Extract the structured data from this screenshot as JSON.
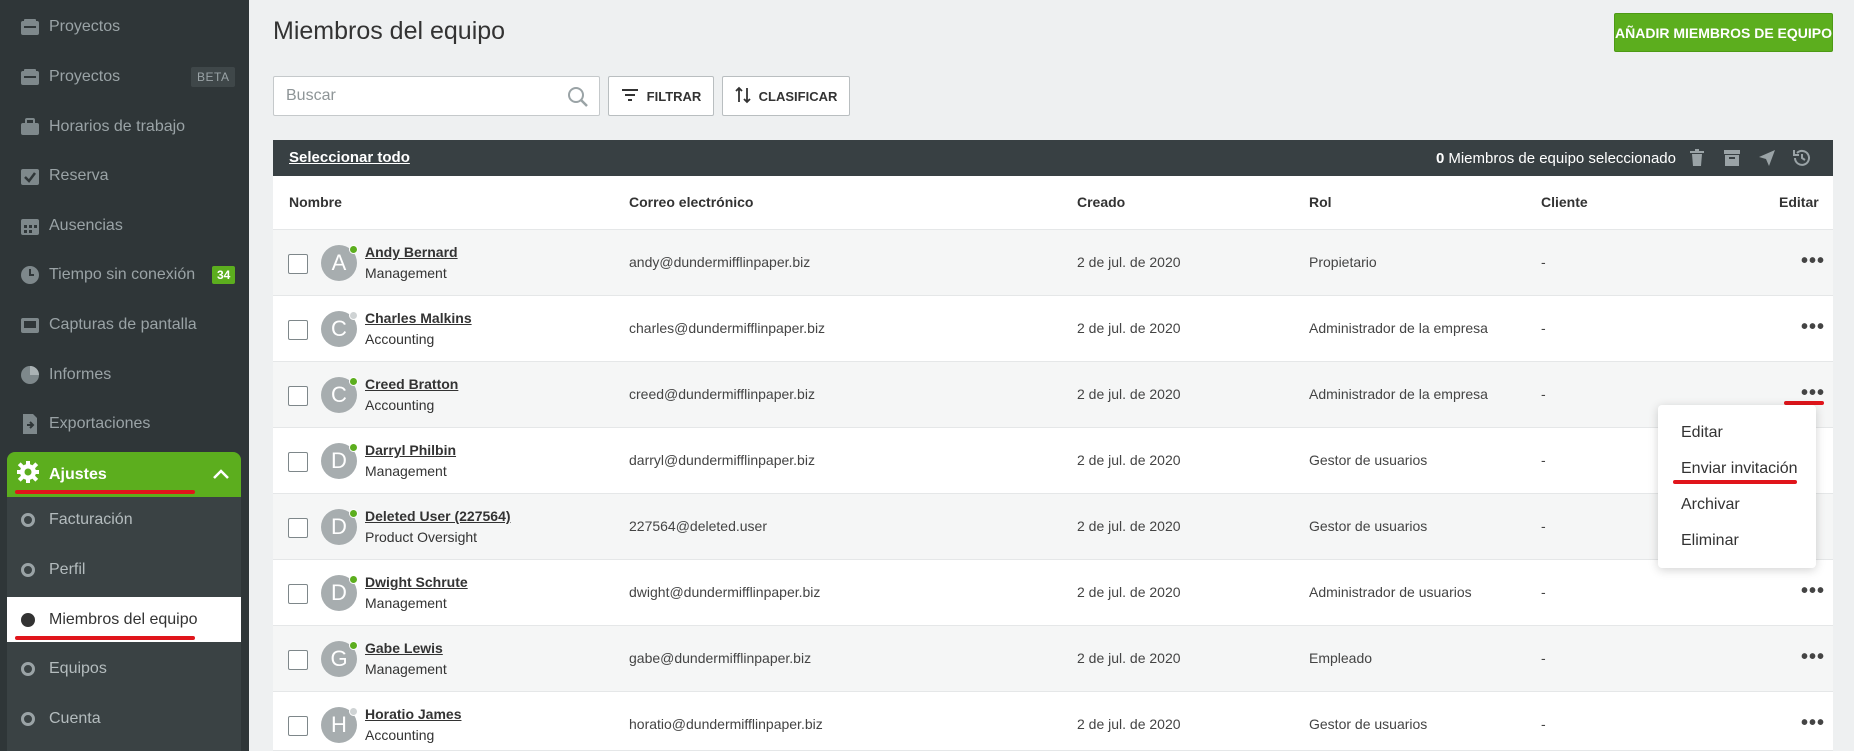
{
  "sidebar": {
    "items": [
      {
        "label": "Proyectos",
        "icon": "folder-icon"
      },
      {
        "label": "Proyectos",
        "icon": "folder-icon",
        "badge": "BETA"
      },
      {
        "label": "Horarios de trabajo",
        "icon": "briefcase-icon"
      },
      {
        "label": "Reserva",
        "icon": "calendar-check-icon"
      },
      {
        "label": "Ausencias",
        "icon": "calendar-icon"
      },
      {
        "label": "Tiempo sin conexión",
        "icon": "clock-icon",
        "badge": "34"
      },
      {
        "label": "Capturas de pantalla",
        "icon": "screenshot-icon"
      },
      {
        "label": "Informes",
        "icon": "pie-chart-icon"
      },
      {
        "label": "Exportaciones",
        "icon": "export-icon"
      }
    ],
    "settings": {
      "label": "Ajustes",
      "icon": "gear-icon",
      "items": [
        {
          "label": "Facturación"
        },
        {
          "label": "Perfil"
        },
        {
          "label": "Miembros del equipo",
          "active": true
        },
        {
          "label": "Equipos"
        },
        {
          "label": "Cuenta"
        }
      ]
    }
  },
  "header": {
    "title": "Miembros del equipo",
    "add_button": "AÑADIR MIEMBROS DE EQUIPO"
  },
  "toolbar": {
    "search_placeholder": "Buscar",
    "filter_label": "FILTRAR",
    "sort_label": "CLASIFICAR"
  },
  "table": {
    "select_all": "Seleccionar todo",
    "selected_count": "0",
    "selected_text": "Miembros de equipo seleccionado",
    "columns": [
      "Nombre",
      "Correo electrónico",
      "Creado",
      "Rol",
      "Cliente",
      "Editar"
    ],
    "rows": [
      {
        "initial": "A",
        "name": "Andy Bernard",
        "dept": "Management",
        "email": "andy@dundermifflinpaper.biz",
        "created": "2 de jul. de 2020",
        "role": "Propietario",
        "client": "-",
        "online": true
      },
      {
        "initial": "C",
        "name": "Charles Malkins",
        "dept": "Accounting",
        "email": "charles@dundermifflinpaper.biz",
        "created": "2 de jul. de 2020",
        "role": "Administrador de la empresa",
        "client": "-",
        "online": false
      },
      {
        "initial": "C",
        "name": "Creed Bratton",
        "dept": "Accounting",
        "email": "creed@dundermifflinpaper.biz",
        "created": "2 de jul. de 2020",
        "role": "Administrador de la empresa",
        "client": "-",
        "online": true
      },
      {
        "initial": "D",
        "name": "Darryl Philbin",
        "dept": "Management",
        "email": "darryl@dundermifflinpaper.biz",
        "created": "2 de jul. de 2020",
        "role": "Gestor de usuarios",
        "client": "-",
        "online": true
      },
      {
        "initial": "D",
        "name": "Deleted User (227564)",
        "dept": "Product Oversight",
        "email": "227564@deleted.user",
        "created": "2 de jul. de 2020",
        "role": "Gestor de usuarios",
        "client": "-",
        "online": true
      },
      {
        "initial": "D",
        "name": "Dwight Schrute",
        "dept": "Management",
        "email": "dwight@dundermifflinpaper.biz",
        "created": "2 de jul. de 2020",
        "role": "Administrador de usuarios",
        "client": "-",
        "online": true
      },
      {
        "initial": "G",
        "name": "Gabe Lewis",
        "dept": "Management",
        "email": "gabe@dundermifflinpaper.biz",
        "created": "2 de jul. de 2020",
        "role": "Empleado",
        "client": "-",
        "online": true
      },
      {
        "initial": "H",
        "name": "Horatio James",
        "dept": "Accounting",
        "email": "horatio@dundermifflinpaper.biz",
        "created": "2 de jul. de 2020",
        "role": "Gestor de usuarios",
        "client": "-",
        "online": false
      }
    ]
  },
  "context_menu": {
    "items": [
      "Editar",
      "Enviar invitación",
      "Archivar",
      "Eliminar"
    ]
  },
  "colors": {
    "accent": "#5cae1e",
    "sidebar": "#2f3638",
    "annotation": "#e0151b"
  }
}
